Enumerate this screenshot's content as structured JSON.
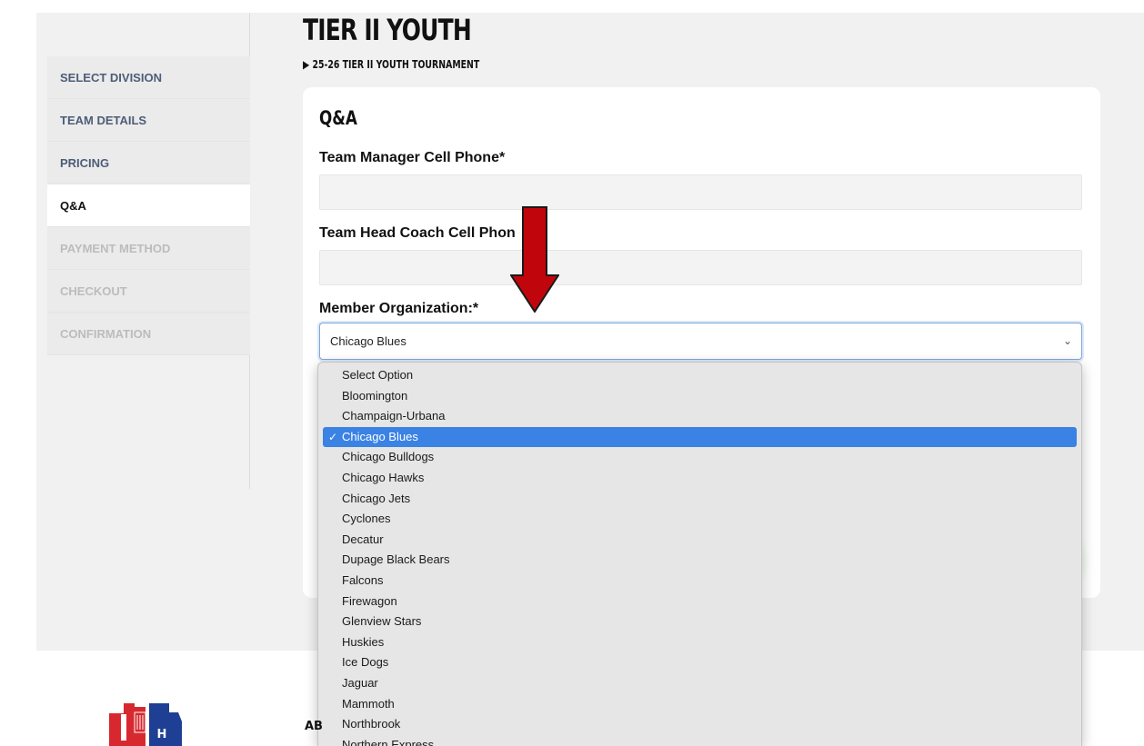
{
  "header": {
    "title": "TIER II YOUTH",
    "breadcrumb": "25-26 TIER II YOUTH TOURNAMENT",
    "breadcrumb_marker": "▶"
  },
  "sidebar": {
    "items": [
      {
        "label": "SELECT DIVISION",
        "state": "completed"
      },
      {
        "label": "TEAM DETAILS",
        "state": "completed"
      },
      {
        "label": "PRICING",
        "state": "completed"
      },
      {
        "label": "Q&A",
        "state": "active"
      },
      {
        "label": "PAYMENT METHOD",
        "state": "disabled"
      },
      {
        "label": "CHECKOUT",
        "state": "disabled"
      },
      {
        "label": "CONFIRMATION",
        "state": "disabled"
      }
    ]
  },
  "form": {
    "section_title": "Q&A",
    "manager_phone": {
      "label": "Team Manager Cell Phone*",
      "value": ""
    },
    "coach_phone": {
      "label": "Team Head Coach Cell Phon",
      "value": ""
    },
    "member_org": {
      "label": "Member Organization:*",
      "value": "Chicago Blues",
      "chevron": "⌄",
      "options": [
        "Select Option",
        "Bloomington",
        "Champaign-Urbana",
        "Chicago Blues",
        "Chicago Bulldogs",
        "Chicago Hawks",
        "Chicago Jets",
        "Cyclones",
        "Decatur",
        "Dupage Black Bears",
        "Falcons",
        "Firewagon",
        "Glenview Stars",
        "Huskies",
        "Ice Dogs",
        "Jaguar",
        "Mammoth",
        "Northbrook",
        "Northern Express"
      ],
      "selected_index": 3,
      "check_glyph": "✓"
    }
  },
  "footer": {
    "heading_fragment": "AB",
    "logo_letter": "H"
  },
  "colors": {
    "arrow": "#c0050c",
    "selected_option": "#3a82e4",
    "logo_red": "#d7282f",
    "logo_blue": "#1f3f95"
  }
}
